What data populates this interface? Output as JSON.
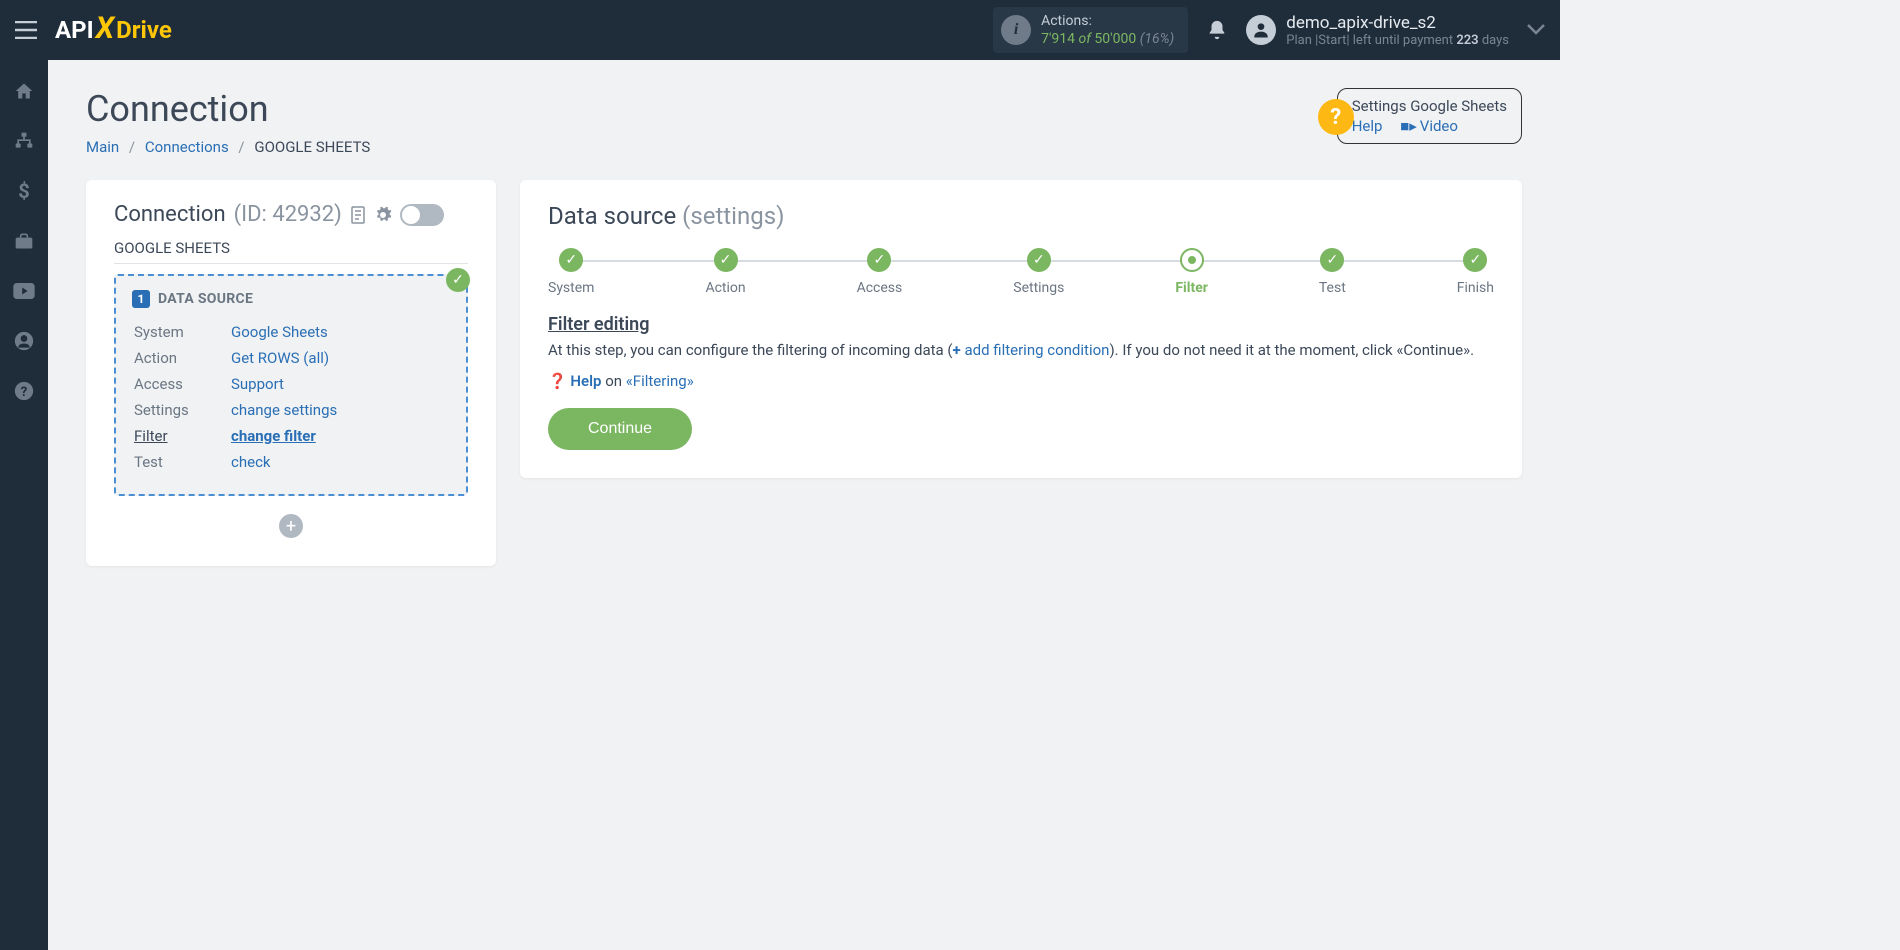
{
  "header": {
    "logo": {
      "api": "API",
      "drive": "Drive"
    },
    "actions": {
      "label": "Actions:",
      "used": "7'914",
      "of": "of",
      "total": "50'000",
      "pct": "(16%)"
    },
    "user": {
      "name": "demo_apix-drive_s2",
      "plan_prefix": "Plan |",
      "plan_name": "Start",
      "plan_mid": "|  left until payment",
      "days_num": "223",
      "days_label": "days"
    }
  },
  "sidebar": {
    "items": [
      "home",
      "network",
      "dollar",
      "briefcase",
      "youtube",
      "user",
      "help"
    ]
  },
  "page": {
    "title": "Connection",
    "breadcrumb": {
      "main": "Main",
      "connections": "Connections",
      "current": "GOOGLE SHEETS"
    },
    "help_box": {
      "title": "Settings Google Sheets",
      "help": "Help",
      "video": "Video"
    }
  },
  "left_card": {
    "title": "Connection",
    "id_label": "(ID: 42932)",
    "subtitle": "GOOGLE SHEETS",
    "source": {
      "num": "1",
      "title": "DATA SOURCE",
      "rows": [
        {
          "label": "System",
          "value": "Google Sheets"
        },
        {
          "label": "Action",
          "value": "Get ROWS (all)"
        },
        {
          "label": "Access",
          "value": "Support"
        },
        {
          "label": "Settings",
          "value": "change settings"
        },
        {
          "label": "Filter",
          "value": "change filter",
          "active": true
        },
        {
          "label": "Test",
          "value": "check"
        }
      ]
    }
  },
  "right_card": {
    "title": "Data source",
    "subtitle": "(settings)",
    "steps": [
      {
        "label": "System",
        "state": "done"
      },
      {
        "label": "Action",
        "state": "done"
      },
      {
        "label": "Access",
        "state": "done"
      },
      {
        "label": "Settings",
        "state": "done"
      },
      {
        "label": "Filter",
        "state": "current"
      },
      {
        "label": "Test",
        "state": "done"
      },
      {
        "label": "Finish",
        "state": "done"
      }
    ],
    "filter": {
      "heading": "Filter editing",
      "desc1": "At this step, you can configure the filtering of incoming data (",
      "add_link": "add filtering condition",
      "desc2": "). If you do not need it at the moment, click «Continue».",
      "help_label": "Help",
      "help_on": "on",
      "help_topic": "«Filtering»"
    },
    "continue": "Continue"
  }
}
